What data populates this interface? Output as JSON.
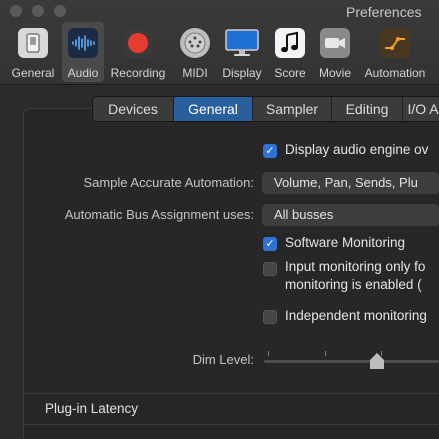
{
  "window": {
    "title": "Preferences"
  },
  "toolbar": {
    "items": [
      {
        "label": "General",
        "icon": "switch-icon"
      },
      {
        "label": "Audio",
        "icon": "waveform-icon"
      },
      {
        "label": "Recording",
        "icon": "record-icon"
      },
      {
        "label": "MIDI",
        "icon": "midi-port-icon"
      },
      {
        "label": "Display",
        "icon": "monitor-icon"
      },
      {
        "label": "Score",
        "icon": "music-note-icon"
      },
      {
        "label": "Movie",
        "icon": "camera-icon"
      },
      {
        "label": "Automation",
        "icon": "automation-curve-icon"
      }
    ],
    "selected": "Audio"
  },
  "tabs": [
    {
      "label": "Devices"
    },
    {
      "label": "General"
    },
    {
      "label": "Sampler"
    },
    {
      "label": "Editing"
    },
    {
      "label": "I/O A"
    }
  ],
  "active_tab": "General",
  "settings": {
    "display_engine_label": "Display audio engine ov",
    "display_engine_checked": true,
    "sample_accurate_label": "Sample Accurate Automation:",
    "sample_accurate_value": "Volume, Pan, Sends, Plu",
    "auto_bus_label": "Automatic Bus Assignment uses:",
    "auto_bus_value": "All busses",
    "software_monitoring_label": "Software Monitoring",
    "software_monitoring_checked": true,
    "input_monitoring_line1": "Input monitoring only fo",
    "input_monitoring_line2": "monitoring is enabled (",
    "input_monitoring_checked": false,
    "independent_monitoring_label": "Independent monitoring",
    "independent_monitoring_checked": false,
    "dim_level_label": "Dim Level:",
    "dim_level_fraction": 0.5
  },
  "plugin_latency": {
    "title": "Plug-in Latency"
  },
  "colors": {
    "accent": "#2f72d6",
    "tab_active": "#2a5f9e",
    "record": "#e63b2e"
  }
}
